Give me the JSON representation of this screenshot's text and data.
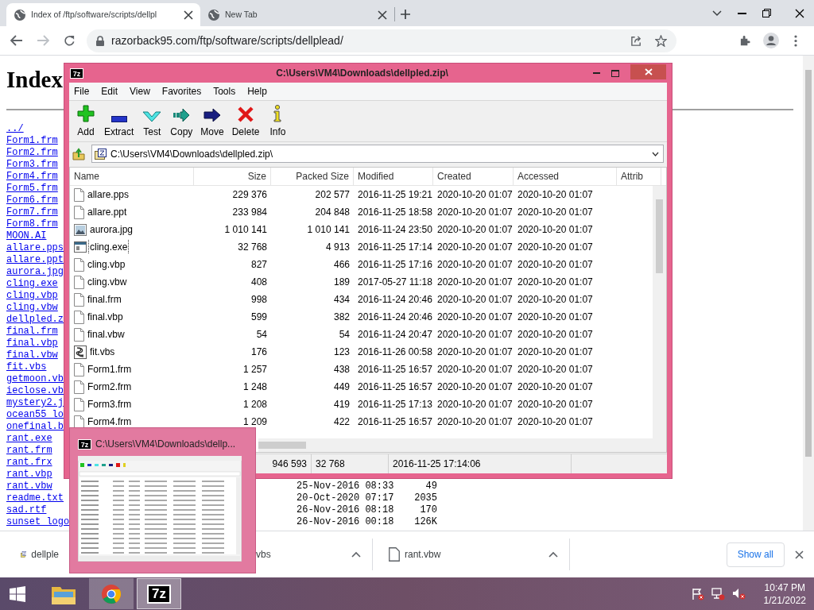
{
  "browser": {
    "tabs": [
      {
        "title": "Index of /ftp/software/scripts/dellpl",
        "selected": true
      },
      {
        "title": "New Tab",
        "selected": false
      }
    ],
    "url": "razorback95.com/ftp/software/scripts/dellplead/"
  },
  "page": {
    "heading": "Index",
    "entries": [
      {
        "name": "../"
      },
      {
        "name": "Form1.frm"
      },
      {
        "name": "Form2.frm"
      },
      {
        "name": "Form3.frm"
      },
      {
        "name": "Form4.frm"
      },
      {
        "name": "Form5.frm"
      },
      {
        "name": "Form6.frm"
      },
      {
        "name": "Form7.frm"
      },
      {
        "name": "Form8.frm"
      },
      {
        "name": "MOON.AI"
      },
      {
        "name": "allare.pps"
      },
      {
        "name": "allare.ppt"
      },
      {
        "name": "aurora.jpg"
      },
      {
        "name": "cling.exe"
      },
      {
        "name": "cling.vbp"
      },
      {
        "name": "cling.vbw"
      },
      {
        "name": "dellpled.z"
      },
      {
        "name": "final.frm"
      },
      {
        "name": "final.vbp"
      },
      {
        "name": "final.vbw"
      },
      {
        "name": "fit.vbs"
      },
      {
        "name": "getmoon.vb"
      },
      {
        "name": "ieclose.vb"
      },
      {
        "name": "mystery2.j"
      },
      {
        "name": "ocean55_lo"
      },
      {
        "name": "onefinal.b"
      },
      {
        "name": "rant.exe"
      },
      {
        "name": "rant.frm"
      },
      {
        "name": "rant.frx"
      },
      {
        "name": "rant.vbp"
      },
      {
        "name": "rant.vbw",
        "date": "25-Nov-2016 08:33",
        "size": "49"
      },
      {
        "name": "readme.txt",
        "date": "20-Oct-2020 07:17",
        "size": "2035"
      },
      {
        "name": "sad.rtf",
        "date": "26-Nov-2016 08:18",
        "size": "170"
      },
      {
        "name": "sunset_logo",
        "date": "26-Nov-2016 00:18",
        "size": "126K"
      }
    ]
  },
  "archive_window": {
    "logo": "7z",
    "title": "C:\\Users\\VM4\\Downloads\\dellpled.zip\\",
    "menu": [
      "File",
      "Edit",
      "View",
      "Favorites",
      "Tools",
      "Help"
    ],
    "toolbar": [
      {
        "kind": "add",
        "label": "Add"
      },
      {
        "kind": "extract",
        "label": "Extract"
      },
      {
        "kind": "test",
        "label": "Test"
      },
      {
        "kind": "copy",
        "label": "Copy"
      },
      {
        "kind": "move",
        "label": "Move"
      },
      {
        "kind": "delete",
        "label": "Delete"
      },
      {
        "kind": "info",
        "label": "Info"
      }
    ],
    "path": "C:\\Users\\VM4\\Downloads\\dellpled.zip\\",
    "columns": [
      "Name",
      "Size",
      "Packed Size",
      "Modified",
      "Created",
      "Accessed",
      "Attrib"
    ],
    "rows": [
      {
        "kind": "doc",
        "name": "allare.pps",
        "size": "229 376",
        "packed": "202 577",
        "modified": "2016-11-25 19:21",
        "created": "2020-10-20 01:07",
        "accessed": "2020-10-20 01:07",
        "focused": false
      },
      {
        "kind": "doc",
        "name": "allare.ppt",
        "size": "233 984",
        "packed": "204 848",
        "modified": "2016-11-25 18:58",
        "created": "2020-10-20 01:07",
        "accessed": "2020-10-20 01:07",
        "focused": false
      },
      {
        "kind": "image",
        "name": "aurora.jpg",
        "size": "1 010 141",
        "packed": "1 010 141",
        "modified": "2016-11-24 23:50",
        "created": "2020-10-20 01:07",
        "accessed": "2020-10-20 01:07",
        "focused": false
      },
      {
        "kind": "exe",
        "name": "cling.exe",
        "size": "32 768",
        "packed": "4 913",
        "modified": "2016-11-25 17:14",
        "created": "2020-10-20 01:07",
        "accessed": "2020-10-20 01:07",
        "focused": true
      },
      {
        "kind": "doc",
        "name": "cling.vbp",
        "size": "827",
        "packed": "466",
        "modified": "2016-11-25 17:16",
        "created": "2020-10-20 01:07",
        "accessed": "2020-10-20 01:07",
        "focused": false
      },
      {
        "kind": "doc",
        "name": "cling.vbw",
        "size": "408",
        "packed": "189",
        "modified": "2017-05-27 11:18",
        "created": "2020-10-20 01:07",
        "accessed": "2020-10-20 01:07",
        "focused": false
      },
      {
        "kind": "doc",
        "name": "final.frm",
        "size": "998",
        "packed": "434",
        "modified": "2016-11-24 20:46",
        "created": "2020-10-20 01:07",
        "accessed": "2020-10-20 01:07",
        "focused": false
      },
      {
        "kind": "doc",
        "name": "final.vbp",
        "size": "599",
        "packed": "382",
        "modified": "2016-11-24 20:46",
        "created": "2020-10-20 01:07",
        "accessed": "2020-10-20 01:07",
        "focused": false
      },
      {
        "kind": "doc",
        "name": "final.vbw",
        "size": "54",
        "packed": "54",
        "modified": "2016-11-24 20:47",
        "created": "2020-10-20 01:07",
        "accessed": "2020-10-20 01:07",
        "focused": false
      },
      {
        "kind": "script",
        "name": "fit.vbs",
        "size": "176",
        "packed": "123",
        "modified": "2016-11-26 00:58",
        "created": "2020-10-20 01:07",
        "accessed": "2020-10-20 01:07",
        "focused": false
      },
      {
        "kind": "doc",
        "name": "Form1.frm",
        "size": "1 257",
        "packed": "438",
        "modified": "2016-11-25 16:57",
        "created": "2020-10-20 01:07",
        "accessed": "2020-10-20 01:07",
        "focused": false
      },
      {
        "kind": "doc",
        "name": "Form2.frm",
        "size": "1 248",
        "packed": "449",
        "modified": "2016-11-25 16:57",
        "created": "2020-10-20 01:07",
        "accessed": "2020-10-20 01:07",
        "focused": false
      },
      {
        "kind": "doc",
        "name": "Form3.frm",
        "size": "1 208",
        "packed": "419",
        "modified": "2016-11-25 17:13",
        "created": "2020-10-20 01:07",
        "accessed": "2020-10-20 01:07",
        "focused": false
      },
      {
        "kind": "doc",
        "name": "Form4.frm",
        "size": "1 209",
        "packed": "422",
        "modified": "2016-11-25 16:57",
        "created": "2020-10-20 01:07",
        "accessed": "2020-10-20 01:07",
        "focused": false
      }
    ],
    "status": [
      "946 593",
      "32 768",
      "2016-11-25 17:14:06"
    ]
  },
  "thumbnail": {
    "logo": "7z",
    "title": "C:\\Users\\VM4\\Downloads\\dellp..."
  },
  "downloads": {
    "items": [
      {
        "kind": "archive",
        "name": "dellple"
      },
      {
        "name": "vbs"
      },
      {
        "kind": "file",
        "name": "rant.vbw"
      }
    ],
    "show_all": "Show all"
  },
  "taskbar": {
    "apps": [
      {
        "kind": "explorer",
        "hovered": false,
        "selected": false
      },
      {
        "kind": "chrome",
        "hovered": true,
        "selected": false
      },
      {
        "kind": "archiver",
        "label": "7z",
        "hovered": false,
        "selected": true
      }
    ],
    "time": "10:47 PM",
    "date": "1/21/2022"
  }
}
